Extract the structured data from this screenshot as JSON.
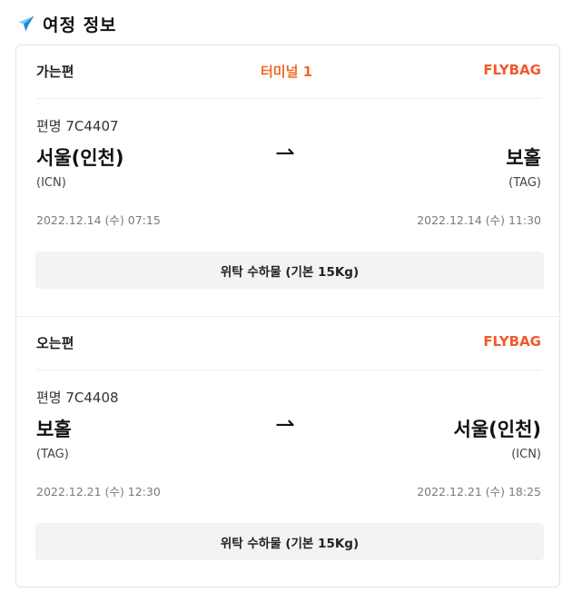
{
  "header": {
    "icon": "airplane-icon",
    "title": "여정 정보"
  },
  "outbound": {
    "label": "가는편",
    "terminal": "터미널 1",
    "flybag": "FLYBAG",
    "flight_no": "편명 7C4407",
    "depart_city": "서울(인천)",
    "depart_code": "(ICN)",
    "arrow": "⇀",
    "arrive_city": "보홀",
    "arrive_code": "(TAG)",
    "depart_time": "2022.12.14 (수) 07:15",
    "arrive_time": "2022.12.14 (수) 11:30",
    "baggage": "위탁 수하물 (기본 15Kg)"
  },
  "inbound": {
    "label": "오는편",
    "flybag": "FLYBAG",
    "flight_no": "편명 7C4408",
    "depart_city": "보홀",
    "depart_code": "(TAG)",
    "arrow": "⇀",
    "arrive_city": "서울(인천)",
    "arrive_code": "(ICN)",
    "depart_time": "2022.12.21 (수) 12:30",
    "arrive_time": "2022.12.21 (수) 18:25",
    "baggage": "위탁 수하물 (기본 15Kg)"
  },
  "colors": {
    "accent": "#f05a28",
    "plane_light": "#7ec8f0",
    "plane_dark": "#1e88d8"
  }
}
